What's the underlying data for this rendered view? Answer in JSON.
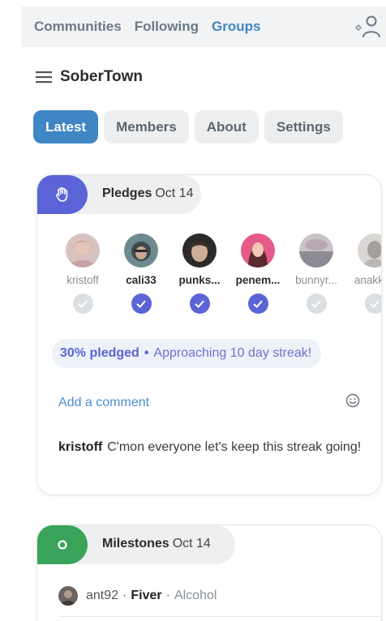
{
  "nav": {
    "links": [
      "Communities",
      "Following",
      "Groups"
    ],
    "active": "Groups"
  },
  "group": {
    "title": "SoberTown"
  },
  "tabs": [
    {
      "label": "Latest",
      "active": true
    },
    {
      "label": "Members",
      "active": false
    },
    {
      "label": "About",
      "active": false
    },
    {
      "label": "Settings",
      "active": false
    }
  ],
  "pledges": {
    "title": "Pledges",
    "date": "Oct 14",
    "accent": "#5b64d6",
    "members": [
      {
        "name": "kristoff",
        "pledged": false,
        "bold": false
      },
      {
        "name": "cali33",
        "pledged": true,
        "bold": true
      },
      {
        "name": "punks...",
        "pledged": true,
        "bold": true
      },
      {
        "name": "penem...",
        "pledged": true,
        "bold": true
      },
      {
        "name": "bunnyr...",
        "pledged": false,
        "bold": false
      },
      {
        "name": "anakki...",
        "pledged": false,
        "bold": false
      }
    ],
    "status_pct": "30% pledged",
    "status_sep": "•",
    "status_streak": "Approaching 10 day streak!",
    "add_comment": "Add a comment",
    "comment": {
      "author": "kristoff",
      "text": "C'mon everyone let's keep this streak going!"
    }
  },
  "milestones": {
    "title": "Milestones",
    "date": "Oct 14",
    "accent": "#3aa35a",
    "entry": {
      "user": "ant92",
      "sep1": "·",
      "name": "Fiver",
      "sep2": "·",
      "category": "Alcohol"
    }
  },
  "colors": {
    "primary": "#3f86c4",
    "pledge_purple": "#5b64d6",
    "milestone_green": "#3aa35a"
  }
}
